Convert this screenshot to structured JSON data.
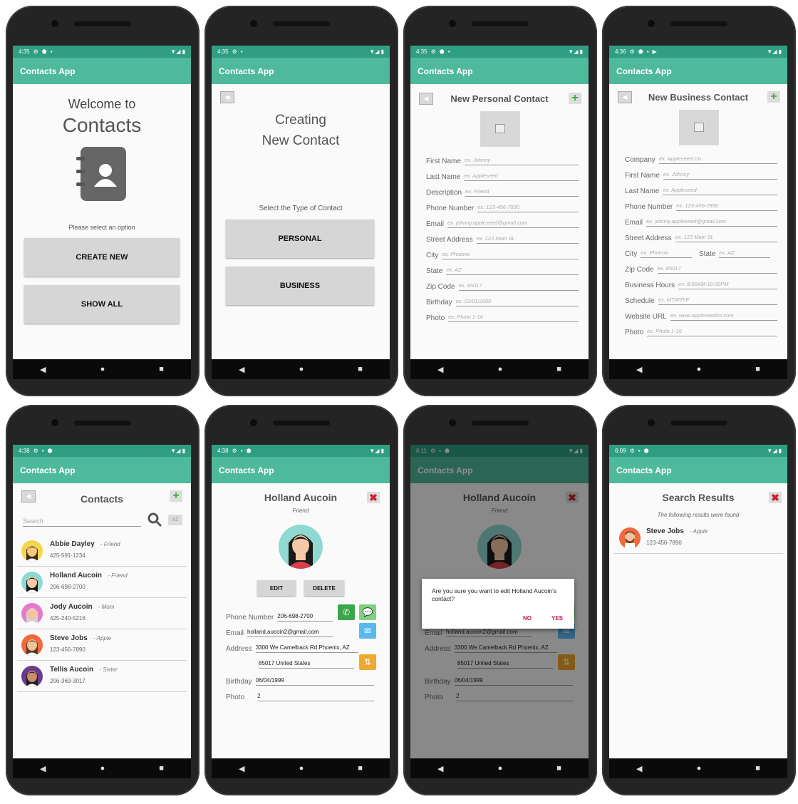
{
  "status": {
    "p1": "4:35",
    "p2": "4:35",
    "p3": "4:35",
    "p4": "4:36",
    "p5": "4:38",
    "p6": "4:38",
    "p7": "6:11",
    "p8": "6:09"
  },
  "app_title": "Contacts App",
  "nav": {
    "back": "◀",
    "home": "●",
    "recent": "■"
  },
  "welcome": {
    "line1": "Welcome to",
    "line2": "Contacts",
    "prompt": "Please select an option",
    "create_new": "CREATE NEW",
    "show_all": "SHOW ALL"
  },
  "creating": {
    "line1": "Creating",
    "line2": "New Contact",
    "prompt": "Select the Type of Contact",
    "personal": "PERSONAL",
    "business": "BUSINESS"
  },
  "personal_form": {
    "title": "New Personal Contact",
    "fields": [
      {
        "label": "First Name",
        "placeholder": "ex. Johnny"
      },
      {
        "label": "Last Name",
        "placeholder": "ex. Appleseed"
      },
      {
        "label": "Description",
        "placeholder": "ex. Friend"
      },
      {
        "label": "Phone Number",
        "placeholder": "ex. 123-456-7890"
      },
      {
        "label": "Email",
        "placeholder": "ex. johnny.appleseed@gmail.com"
      },
      {
        "label": "Street Address",
        "placeholder": "ex. 123 Main St."
      },
      {
        "label": "City",
        "placeholder": "ex. Phoenix"
      },
      {
        "label": "State",
        "placeholder": "ex. AZ"
      },
      {
        "label": "Zip Code",
        "placeholder": "ex. 85017"
      },
      {
        "label": "Birthday",
        "placeholder": "ex. 01/01/2000"
      },
      {
        "label": "Photo",
        "placeholder": "ex. Photo 1-16"
      }
    ]
  },
  "business_form": {
    "title": "New Business Contact",
    "fields": [
      {
        "label": "Company",
        "placeholder": "ex. Appleseed Co."
      },
      {
        "label": "First Name",
        "placeholder": "ex. Johnny"
      },
      {
        "label": "Last Name",
        "placeholder": "ex. Appleseed"
      },
      {
        "label": "Phone Number",
        "placeholder": "ex. 123-456-7890"
      },
      {
        "label": "Email",
        "placeholder": "ex. johnny.appleseed@gmail.com"
      },
      {
        "label": "Street Address",
        "placeholder": "ex. 123 Main St."
      },
      {
        "label": "City",
        "placeholder": "ex. Phoenix"
      },
      {
        "label": "State",
        "placeholder": "ex. AZ"
      },
      {
        "label": "Zip Code",
        "placeholder": "ex. 85017"
      },
      {
        "label": "Business Hours",
        "placeholder": "ex. 8:00AM-10:00PM"
      },
      {
        "label": "Schedule",
        "placeholder": "ex. MTWThF"
      },
      {
        "label": "Website URL",
        "placeholder": "ex. www.appleseedco.com"
      },
      {
        "label": "Photo",
        "placeholder": "ex. Photo 1-16"
      }
    ]
  },
  "contacts_list": {
    "title": "Contacts",
    "search_placeholder": "Search",
    "az_label": "AZ",
    "contacts": [
      {
        "name": "Abbie Dayley",
        "relation": "Friend",
        "phone": "425-591-1234",
        "skin": "#f2c879",
        "hair": "#3b2a20",
        "bg": "#f5d54a"
      },
      {
        "name": "Holland Aucoin",
        "relation": "Friend",
        "phone": "206-698-2700",
        "skin": "#f5c9a7",
        "hair": "#1a1a1a",
        "bg": "#8fd9d1"
      },
      {
        "name": "Jody Aucoin",
        "relation": "Mom",
        "phone": "425-240-5216",
        "skin": "#f3c4a0",
        "hair": "#d3d3d3",
        "bg": "#e57acb"
      },
      {
        "name": "Steve Jobs",
        "relation": "Apple",
        "phone": "123-456-7890",
        "skin": "#f0c39a",
        "hair": "#5a3a28",
        "bg": "#f06a3d"
      },
      {
        "name": "Tellis Aucoin",
        "relation": "Sister",
        "phone": "206-369-3017",
        "skin": "#c98f6a",
        "hair": "#222",
        "bg": "#6a3c8c"
      }
    ]
  },
  "detail": {
    "name": "Holland Aucoin",
    "relation": "Friend",
    "edit": "EDIT",
    "delete": "DELETE",
    "phone_label": "Phone Number",
    "phone": "206-698-2700",
    "email_label": "Email",
    "email": "holland.aucoin2@gmail.com",
    "address_label": "Address",
    "address1": "3300 We Camelback Rd Phoenix, AZ",
    "address2": "85017 United States",
    "birthday_label": "Birthday",
    "birthday": "06/04/1999",
    "photo_label": "Photo",
    "photo": "2"
  },
  "dialog": {
    "message": "Are you sure you want to edit Holland Aucoin's contact?",
    "no": "NO",
    "yes": "YES"
  },
  "search_results": {
    "title": "Search Results",
    "subtitle": "The following results were found",
    "name": "Steve Jobs",
    "relation": "Apple",
    "phone": "123-456-7890"
  },
  "colors": {
    "accent": "#4fb99c",
    "status": "#2f9e82",
    "plus": "#3cae3c",
    "close": "#d0202c",
    "dialog_action": "#c2185b"
  }
}
